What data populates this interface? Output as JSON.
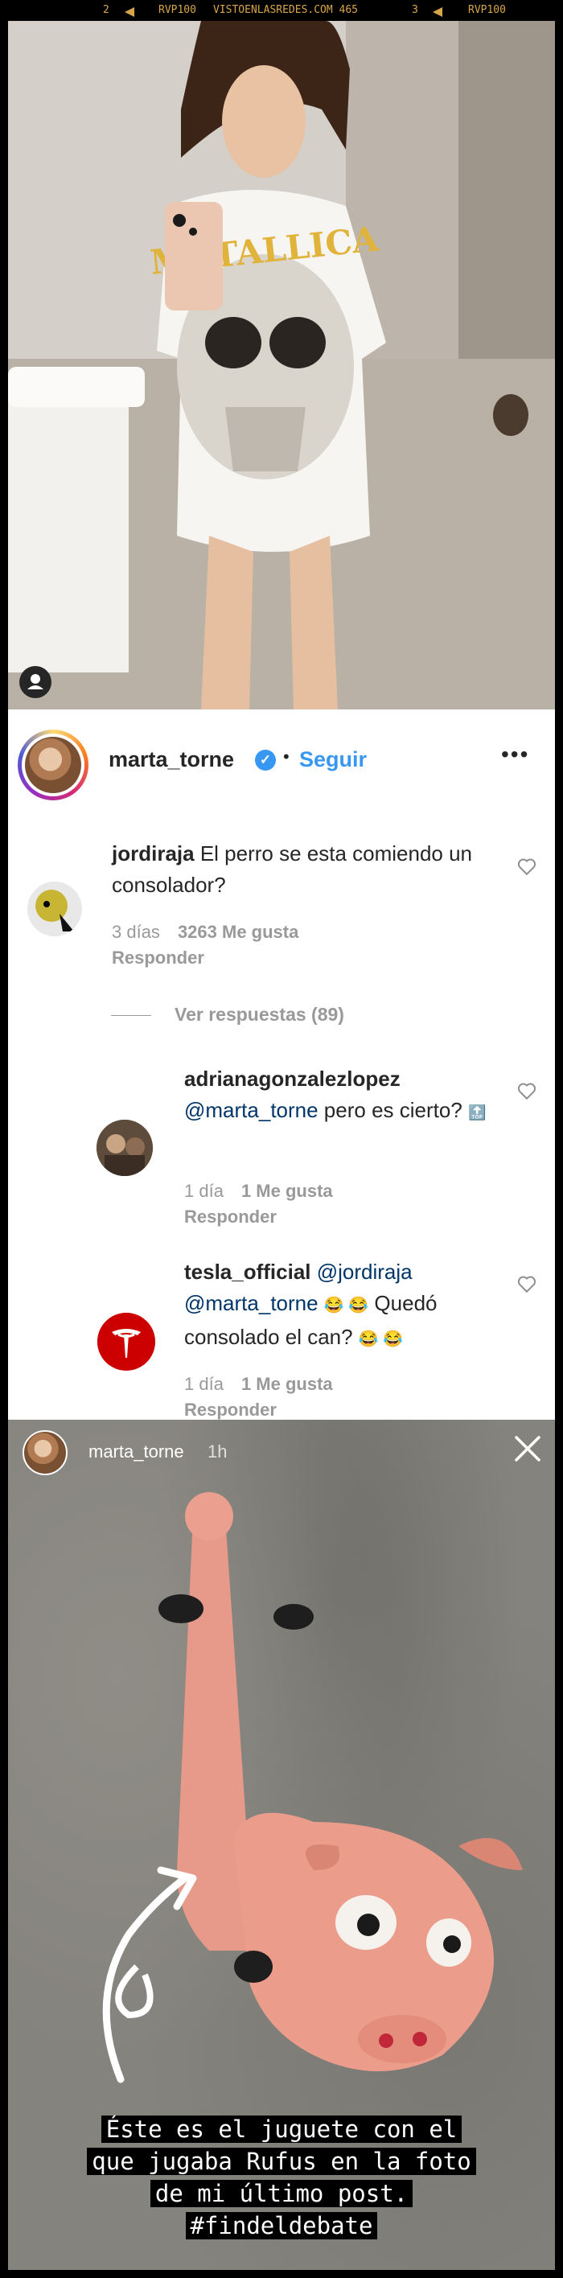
{
  "filmstrip": {
    "frame_left": "2",
    "code_left": "RVP100",
    "watermark": "VISTOENLASREDES.COM 465",
    "frame_right": "3",
    "code_right": "RVP100"
  },
  "post": {
    "username": "marta_torne",
    "verified_icon": "verified-check-icon",
    "separator": "•",
    "follow_label": "Seguir",
    "more_label": "•••"
  },
  "comments": [
    {
      "username": "jordiraja",
      "text": "El perro se esta comiendo un consolador?",
      "age": "3 días",
      "likes": "3263 Me gusta",
      "reply_label": "Responder"
    }
  ],
  "view_replies": "Ver respuestas (89)",
  "replies": [
    {
      "username": "adrianagonzalezlopez",
      "mention": "@marta_torne",
      "text": " pero es cierto?",
      "emoji": "🔝",
      "age": "1 día",
      "likes": "1 Me gusta",
      "reply_label": "Responder"
    },
    {
      "username": "tesla_official",
      "mention1": "@jordiraja",
      "mention2": "@marta_torne",
      "emoji1": "😂 😂",
      "text": "Quedó consolado el can?",
      "emoji2": "😂 😂",
      "age": "1 día",
      "likes": "1 Me gusta",
      "reply_label": "Responder"
    }
  ],
  "story": {
    "username": "marta_torne",
    "time": "1h",
    "caption_lines": [
      "Éste es el juguete con el",
      "que jugaba Rufus en la foto",
      "de mi último post.",
      "#findeldebate"
    ]
  },
  "colors": {
    "brand_blue": "#3897f0",
    "mention_blue": "#003569",
    "meta_gray": "#999999",
    "tesla_red": "#cc0000"
  }
}
